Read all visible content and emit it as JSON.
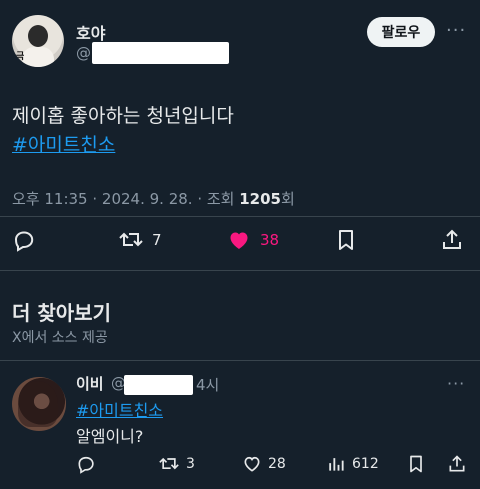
{
  "post": {
    "display_name": "호야",
    "handle_prefix": "@",
    "follow_label": "팔로우",
    "more_label": "···",
    "text": "제이홉 좋아하는 청년입니다",
    "hashtag": "#아미트친소",
    "meta_time": "오후 11:35 · 2024. 9. 28. · 조회 ",
    "views": "1205",
    "views_suffix": "회",
    "actions": {
      "retweets": "7",
      "likes": "38"
    },
    "colors": {
      "like": "#f91880",
      "link": "#1d9bf0"
    }
  },
  "explore": {
    "title": "더 찾아보기",
    "subtitle": "X에서 소스 제공"
  },
  "reply": {
    "display_name": "이비",
    "handle_prefix": "@",
    "time": "4시",
    "more_label": "···",
    "hashtag": "#아미트친소",
    "text": "알엠이니?",
    "actions": {
      "retweets": "3",
      "likes": "28",
      "views": "612"
    }
  }
}
